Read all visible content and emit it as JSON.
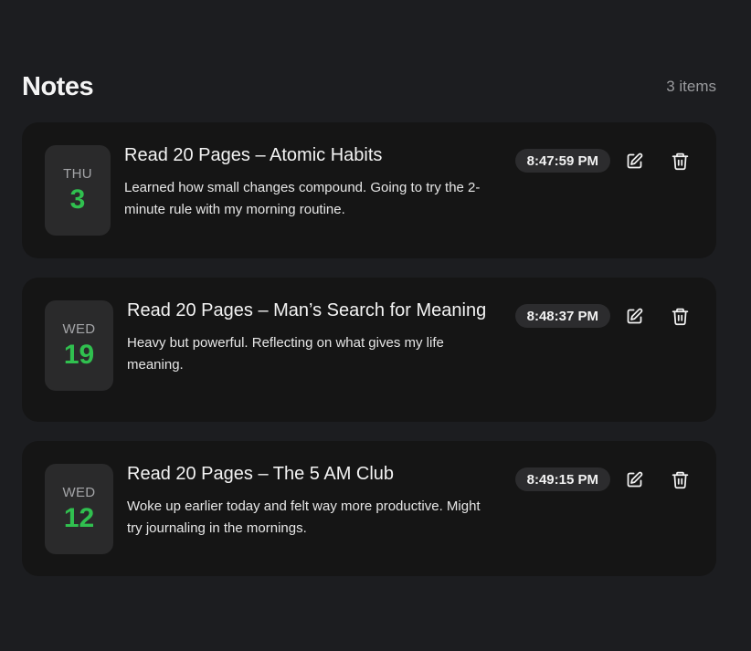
{
  "header": {
    "title": "Notes",
    "count": "3 items"
  },
  "notes": [
    {
      "dow": "THU",
      "day": "3",
      "title": "Read 20 Pages – Atomic Habits",
      "body": "Learned how small changes compound. Going to try the 2-minute rule with my morning routine.",
      "time": "8:47:59 PM"
    },
    {
      "dow": "WED",
      "day": "19",
      "title": "Read 20 Pages – Man’s Search for Meaning",
      "body": "Heavy but powerful. Reflecting on what gives my life meaning.",
      "time": "8:48:37 PM"
    },
    {
      "dow": "WED",
      "day": "12",
      "title": "Read 20 Pages – The 5 AM Club",
      "body": "Woke up earlier today and felt way more productive. Might try journaling in the mornings.",
      "time": "8:49:15 PM"
    }
  ],
  "icons": {
    "edit": "pencil-square-icon",
    "delete": "trash-icon"
  },
  "colors": {
    "background": "#1c1d20",
    "card": "#151515",
    "date_box": "#2a2a2b",
    "accent_green": "#30c04f",
    "time_pill": "#2c2c2e"
  }
}
